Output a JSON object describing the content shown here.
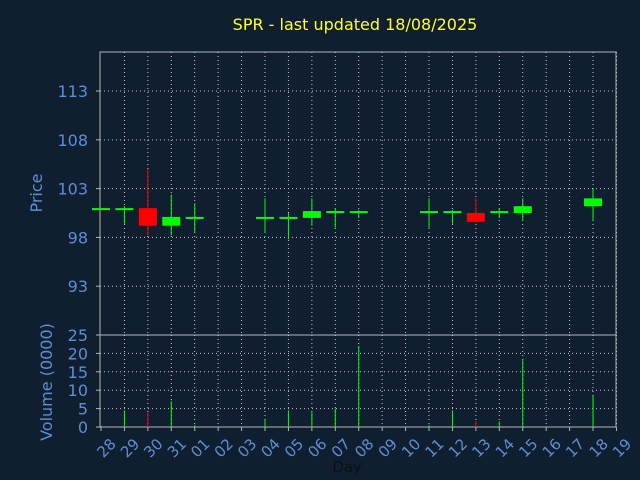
{
  "chart_data": {
    "type": "candlestick",
    "title": "SPR - last updated 18/08/2025",
    "xlabel": "Day",
    "price_ylabel": "Price",
    "volume_ylabel": "Volume (0000)",
    "price_ylim": [
      88,
      117
    ],
    "price_ticks": [
      "93",
      "98",
      "103",
      "108",
      "113"
    ],
    "volume_ylim": [
      0,
      25
    ],
    "volume_ticks": [
      "0",
      "5",
      "10",
      "15",
      "20",
      "25"
    ],
    "x_ticks": [
      "28",
      "29",
      "30",
      "31",
      "01",
      "02",
      "03",
      "04",
      "05",
      "06",
      "07",
      "08",
      "09",
      "10",
      "11",
      "12",
      "13",
      "14",
      "15",
      "16",
      "17",
      "18",
      "19"
    ],
    "grid": true,
    "candles": [
      {
        "day": "28",
        "open": 101.0,
        "high": 101.0,
        "low": 101.0,
        "close": 101.0,
        "volume": 0.3
      },
      {
        "day": "29",
        "open": 101.0,
        "high": 101.2,
        "low": 99.4,
        "close": 101.0,
        "volume": 4.5
      },
      {
        "day": "30",
        "open": 101.0,
        "high": 105.0,
        "low": 98.2,
        "close": 99.2,
        "volume": 4.0
      },
      {
        "day": "31",
        "open": 99.2,
        "high": 102.4,
        "low": 98.2,
        "close": 100.1,
        "volume": 7.0
      },
      {
        "day": "01",
        "open": 100.0,
        "high": 101.5,
        "low": 98.5,
        "close": 100.1,
        "volume": 0.5
      },
      {
        "day": "04",
        "open": 100.0,
        "high": 102.0,
        "low": 98.5,
        "close": 100.1,
        "volume": 2.0
      },
      {
        "day": "05",
        "open": 100.0,
        "high": 100.5,
        "low": 97.8,
        "close": 100.1,
        "volume": 4.5
      },
      {
        "day": "06",
        "open": 100.0,
        "high": 102.0,
        "low": 99.2,
        "close": 100.7,
        "volume": 4.0
      },
      {
        "day": "07",
        "open": 100.5,
        "high": 101.0,
        "low": 99.0,
        "close": 100.7,
        "volume": 5.0
      },
      {
        "day": "08",
        "open": 100.5,
        "high": 100.8,
        "low": 100.0,
        "close": 100.7,
        "volume": 22.0
      },
      {
        "day": "11",
        "open": 100.5,
        "high": 102.0,
        "low": 99.0,
        "close": 100.7,
        "volume": 0.5
      },
      {
        "day": "12",
        "open": 100.5,
        "high": 100.8,
        "low": 99.4,
        "close": 100.7,
        "volume": 4.5
      },
      {
        "day": "13",
        "open": 100.5,
        "high": 102.0,
        "low": 99.5,
        "close": 99.6,
        "volume": 1.5
      },
      {
        "day": "14",
        "open": 100.5,
        "high": 101.0,
        "low": 100.0,
        "close": 100.7,
        "volume": 1.5
      },
      {
        "day": "15",
        "open": 100.5,
        "high": 102.0,
        "low": 99.8,
        "close": 101.2,
        "volume": 18.5
      },
      {
        "day": "18",
        "open": 101.2,
        "high": 103.0,
        "low": 99.8,
        "close": 102.0,
        "volume": 8.5
      }
    ],
    "colors": {
      "background": "#0f1f30",
      "title": "#ffff33",
      "axis_text": "#5b8fd6",
      "x_label": "#0b1016",
      "axes": "#b4b4b4",
      "grid": "#c8c8c8",
      "up": "#00ff00",
      "down": "#ff0000"
    }
  }
}
